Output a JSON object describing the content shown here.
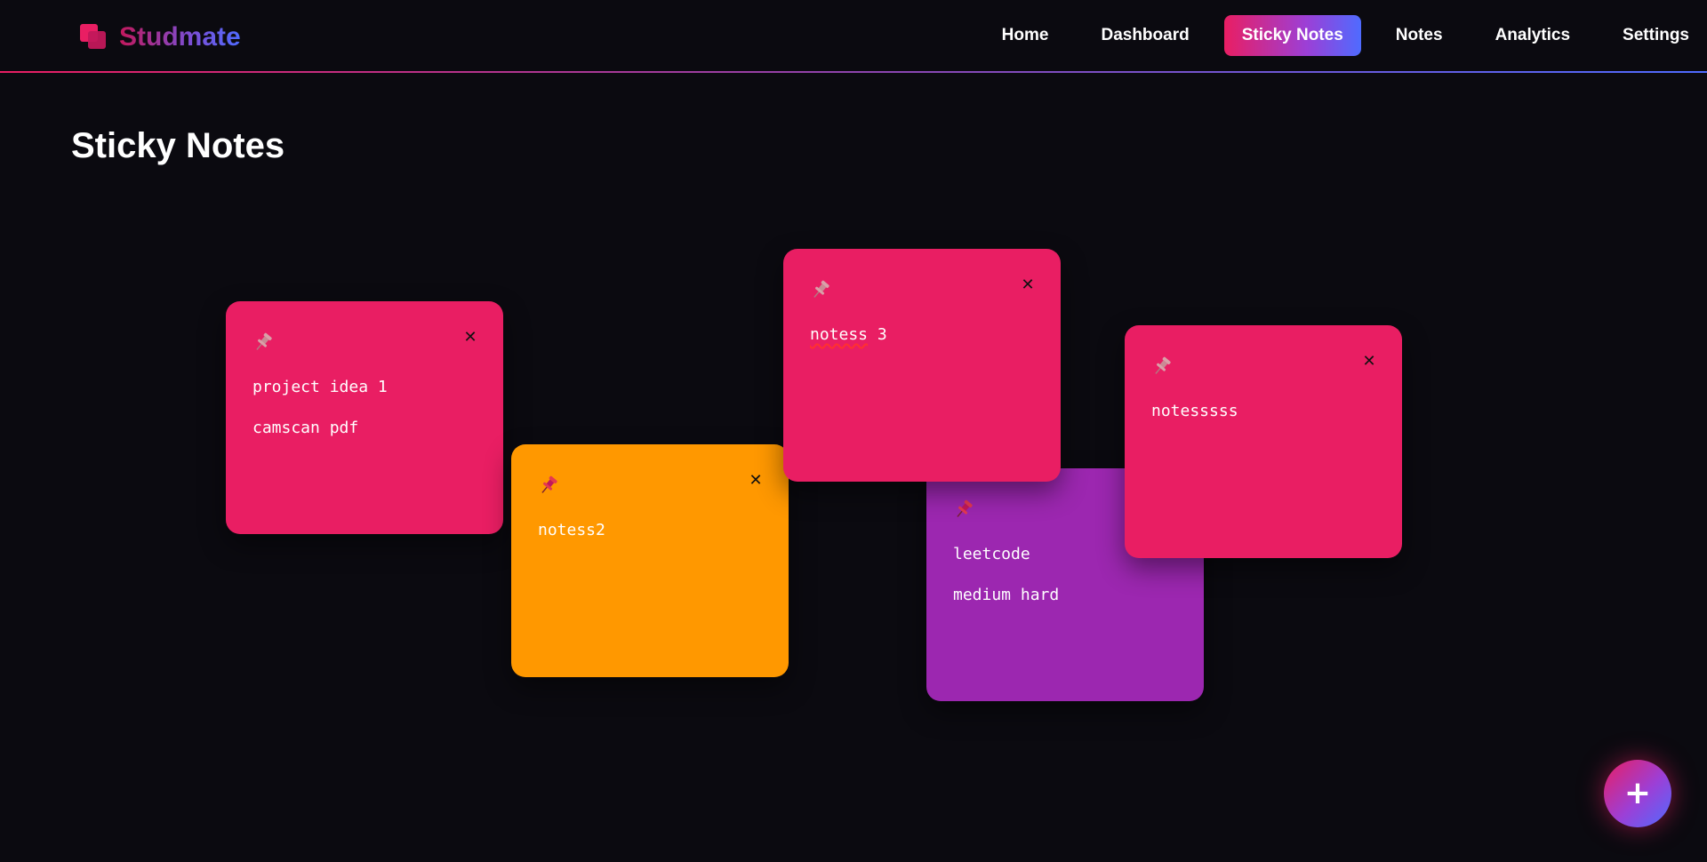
{
  "brand": {
    "name": "Studmate",
    "icon": "stacked-squares-icon",
    "color": "#e91e63"
  },
  "nav": {
    "items": [
      {
        "label": "Home",
        "active": false
      },
      {
        "label": "Dashboard",
        "active": false
      },
      {
        "label": "Sticky Notes",
        "active": true
      },
      {
        "label": "Notes",
        "active": false
      },
      {
        "label": "Analytics",
        "active": false
      },
      {
        "label": "Settings",
        "active": false
      }
    ]
  },
  "page": {
    "title": "Sticky Notes"
  },
  "notes": [
    {
      "text": "project idea 1\ncamscan pdf",
      "color": "#e91e63",
      "pinned": false
    },
    {
      "text": "notess2",
      "color": "#ff9800",
      "pinned": true
    },
    {
      "text": "notess 3",
      "color": "#e91e63",
      "pinned": false
    },
    {
      "text": "leetcode\nmedium hard",
      "color": "#9c27b0",
      "pinned": true
    },
    {
      "text": "notesssss",
      "color": "#e91e63",
      "pinned": false
    }
  ],
  "icons": {
    "pin": "pushpin-icon",
    "close": "close-icon",
    "add": "plus-icon"
  },
  "note_close_label": "✕",
  "fab": {
    "label": "+"
  },
  "colors": {
    "background": "#0b0a10",
    "accent_pink": "#e91e63",
    "accent_purple": "#9c27b0",
    "accent_blue": "#4f6bff",
    "accent_orange": "#ff9800"
  }
}
